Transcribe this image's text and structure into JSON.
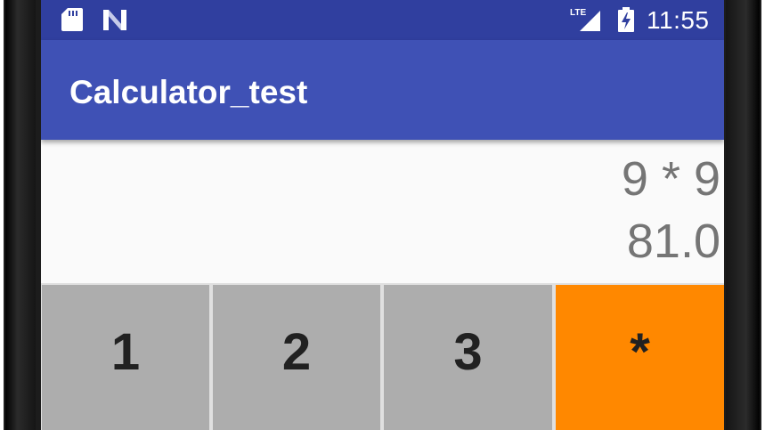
{
  "status_bar": {
    "icons": [
      "sd-card-icon",
      "n-notification-icon",
      "lte-signal-icon",
      "battery-charging-icon"
    ],
    "time": "11:55",
    "lte_label": "LTE",
    "color": "#303f9f"
  },
  "app_bar": {
    "title": "Calculator_test",
    "color": "#3f51b5"
  },
  "display": {
    "expression": "9 * 9",
    "result": "81.0",
    "text_color": "#757575"
  },
  "keypad": {
    "keys": [
      {
        "label": "1",
        "color": "#adadad"
      },
      {
        "label": "2",
        "color": "#adadad"
      },
      {
        "label": "3",
        "color": "#adadad"
      },
      {
        "label": "*",
        "color": "#ff8800"
      }
    ]
  }
}
